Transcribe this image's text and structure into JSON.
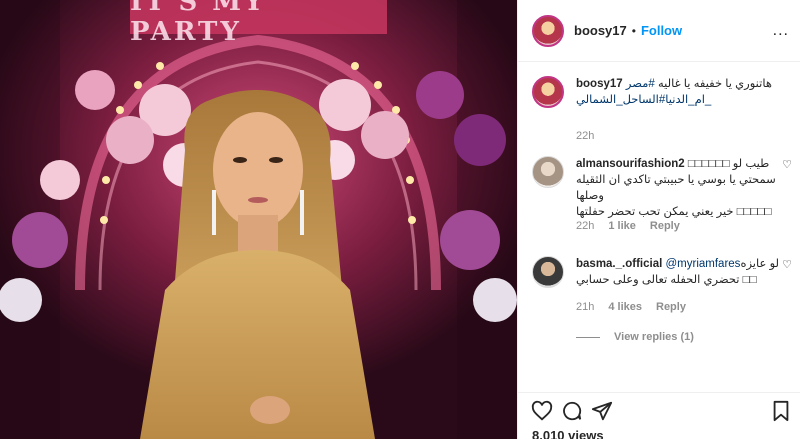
{
  "media": {
    "banner_text": "IT'S MY PARTY"
  },
  "header": {
    "username": "boosy17",
    "separator": "•",
    "follow_label": "Follow",
    "more_label": "..."
  },
  "caption": {
    "username": "boosy17",
    "text_line1": "هاتنوري يا خفيفه يا غاليه",
    "hashtag1": "#مصر",
    "hashtag2": "_ام_الدنيا#الساحل_الشمالي",
    "time": "22h"
  },
  "comments": [
    {
      "username": "almansourifashion2",
      "lines": [
        "طيب لو □□□□□□",
        "سمحتي يا بوسي يا حبيبتي تاكدي ان الثقيله وصلها",
        "□□□□□ خير يعني يمكن تحب تحضر حفلتها"
      ],
      "time": "22h",
      "likes": "1 like",
      "reply": "Reply"
    },
    {
      "username": "basma._.official",
      "mention": "@myriamfares",
      "lines_after_mention": " لو عايزه",
      "lines": [
        "□□ تحضري الحفله تعالى وعلى حسابي"
      ],
      "time": "21h",
      "likes": "4 likes",
      "reply": "Reply",
      "view_replies": "View replies (1)"
    }
  ],
  "actions": {
    "like_icon": "heart-icon",
    "comment_icon": "comment-icon",
    "share_icon": "share-icon",
    "save_icon": "bookmark-icon"
  },
  "views": "8,010 views",
  "colors": {
    "link": "#0095f6",
    "text": "#262626",
    "muted": "#8e8e8e",
    "border": "#efefef"
  }
}
